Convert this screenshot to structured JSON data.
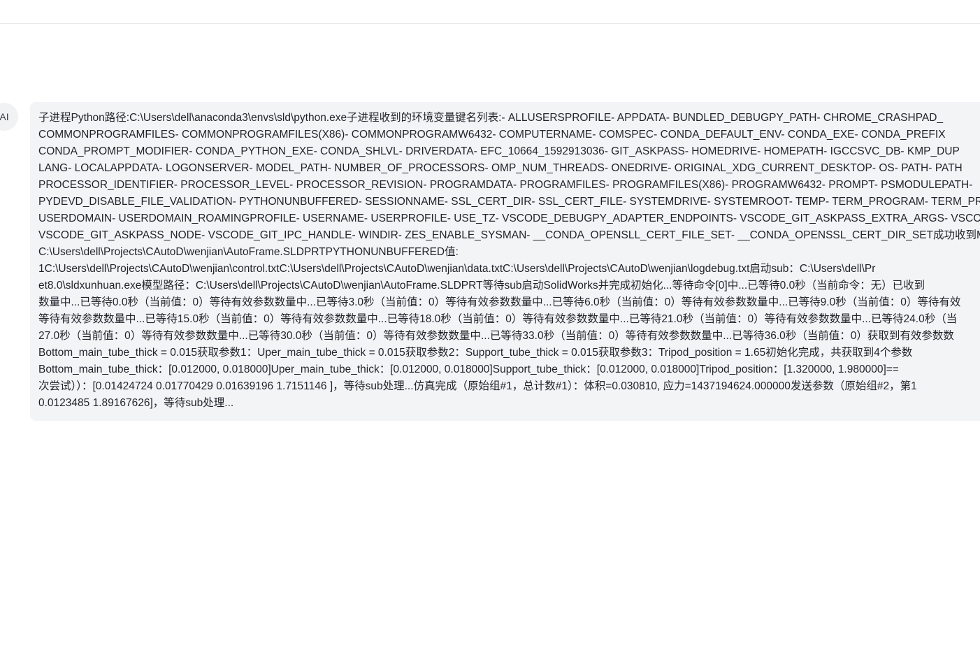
{
  "avatar": {
    "label": "AI"
  },
  "message": {
    "lines": [
      "子进程Python路径:C:\\Users\\dell\\anaconda3\\envs\\sld\\python.exe子进程收到的环境变量键名列表:- ALLUSERSPROFILE- APPDATA- BUNDLED_DEBUGPY_PATH- CHROME_CRASHPAD_",
      "COMMONPROGRAMFILES- COMMONPROGRAMFILES(X86)- COMMONPROGRAMW6432- COMPUTERNAME- COMSPEC- CONDA_DEFAULT_ENV- CONDA_EXE- CONDA_PREFIX",
      "CONDA_PROMPT_MODIFIER- CONDA_PYTHON_EXE- CONDA_SHLVL- DRIVERDATA- EFC_10664_1592913036- GIT_ASKPASS- HOMEDRIVE- HOMEPATH- IGCCSVC_DB- KMP_DUP",
      "LANG- LOCALAPPDATA- LOGONSERVER- MODEL_PATH- NUMBER_OF_PROCESSORS- OMP_NUM_THREADS- ONEDRIVE- ORIGINAL_XDG_CURRENT_DESKTOP- OS- PATH- PATH",
      "PROCESSOR_IDENTIFIER- PROCESSOR_LEVEL- PROCESSOR_REVISION- PROGRAMDATA- PROGRAMFILES- PROGRAMFILES(X86)- PROGRAMW6432- PROMPT- PSMODULEPATH-",
      "PYDEVD_DISABLE_FILE_VALIDATION- PYTHONUNBUFFERED- SESSIONNAME- SSL_CERT_DIR- SSL_CERT_FILE- SYSTEMDRIVE- SYSTEMROOT- TEMP- TERM_PROGRAM- TERM_PR",
      "USERDOMAIN- USERDOMAIN_ROAMINGPROFILE- USERNAME- USERPROFILE- USE_TZ- VSCODE_DEBUGPY_ADAPTER_ENDPOINTS- VSCODE_GIT_ASKPASS_EXTRA_ARGS- VSCO",
      "VSCODE_GIT_ASKPASS_NODE- VSCODE_GIT_IPC_HANDLE- WINDIR- ZES_ENABLE_SYSMAN- __CONDA_OPENSLL_CERT_FILE_SET- __CONDA_OPENSSL_CERT_DIR_SET成功收到MO",
      "C:\\Users\\dell\\Projects\\CAutoD\\wenjian\\AutoFrame.SLDPRTPYTHONUNBUFFERED值:",
      "1C:\\Users\\dell\\Projects\\CAutoD\\wenjian\\control.txtC:\\Users\\dell\\Projects\\CAutoD\\wenjian\\data.txtC:\\Users\\dell\\Projects\\CAutoD\\wenjian\\logdebug.txt启动sub：C:\\Users\\dell\\Pr",
      "et8.0\\sldxunhuan.exe模型路径：C:\\Users\\dell\\Projects\\CAutoD\\wenjian\\AutoFrame.SLDPRT等待sub启动SolidWorks并完成初始化...等待命令[0]中...已等待0.0秒（当前命令：无）已收到",
      "数量中...已等待0.0秒（当前值：0）等待有效参数数量中...已等待3.0秒（当前值：0）等待有效参数数量中...已等待6.0秒（当前值：0）等待有效参数数量中...已等待9.0秒（当前值：0）等待有效",
      "等待有效参数数量中...已等待15.0秒（当前值：0）等待有效参数数量中...已等待18.0秒（当前值：0）等待有效参数数量中...已等待21.0秒（当前值：0）等待有效参数数量中...已等待24.0秒（当",
      "27.0秒（当前值：0）等待有效参数数量中...已等待30.0秒（当前值：0）等待有效参数数量中...已等待33.0秒（当前值：0）等待有效参数数量中...已等待36.0秒（当前值：0）获取到有效参数数",
      "Bottom_main_tube_thick = 0.015获取参数1：Uper_main_tube_thick = 0.015获取参数2：Support_tube_thick = 0.015获取参数3：Tripod_position = 1.65初始化完成，共获取到4个参数",
      "Bottom_main_tube_thick：[0.012000, 0.018000]Uper_main_tube_thick：[0.012000, 0.018000]Support_tube_thick：[0.012000, 0.018000]Tripod_position：[1.320000, 1.980000]==",
      "次尝试））：[0.01424724 0.01770429 0.01639196 1.7151146 ]，等待sub处理...仿真完成（原始组#1，总计数#1）：体积=0.030810, 应力=1437194624.000000发送参数（原始组#2，第1",
      "0.0123485 1.89167626]，等待sub处理..."
    ]
  }
}
